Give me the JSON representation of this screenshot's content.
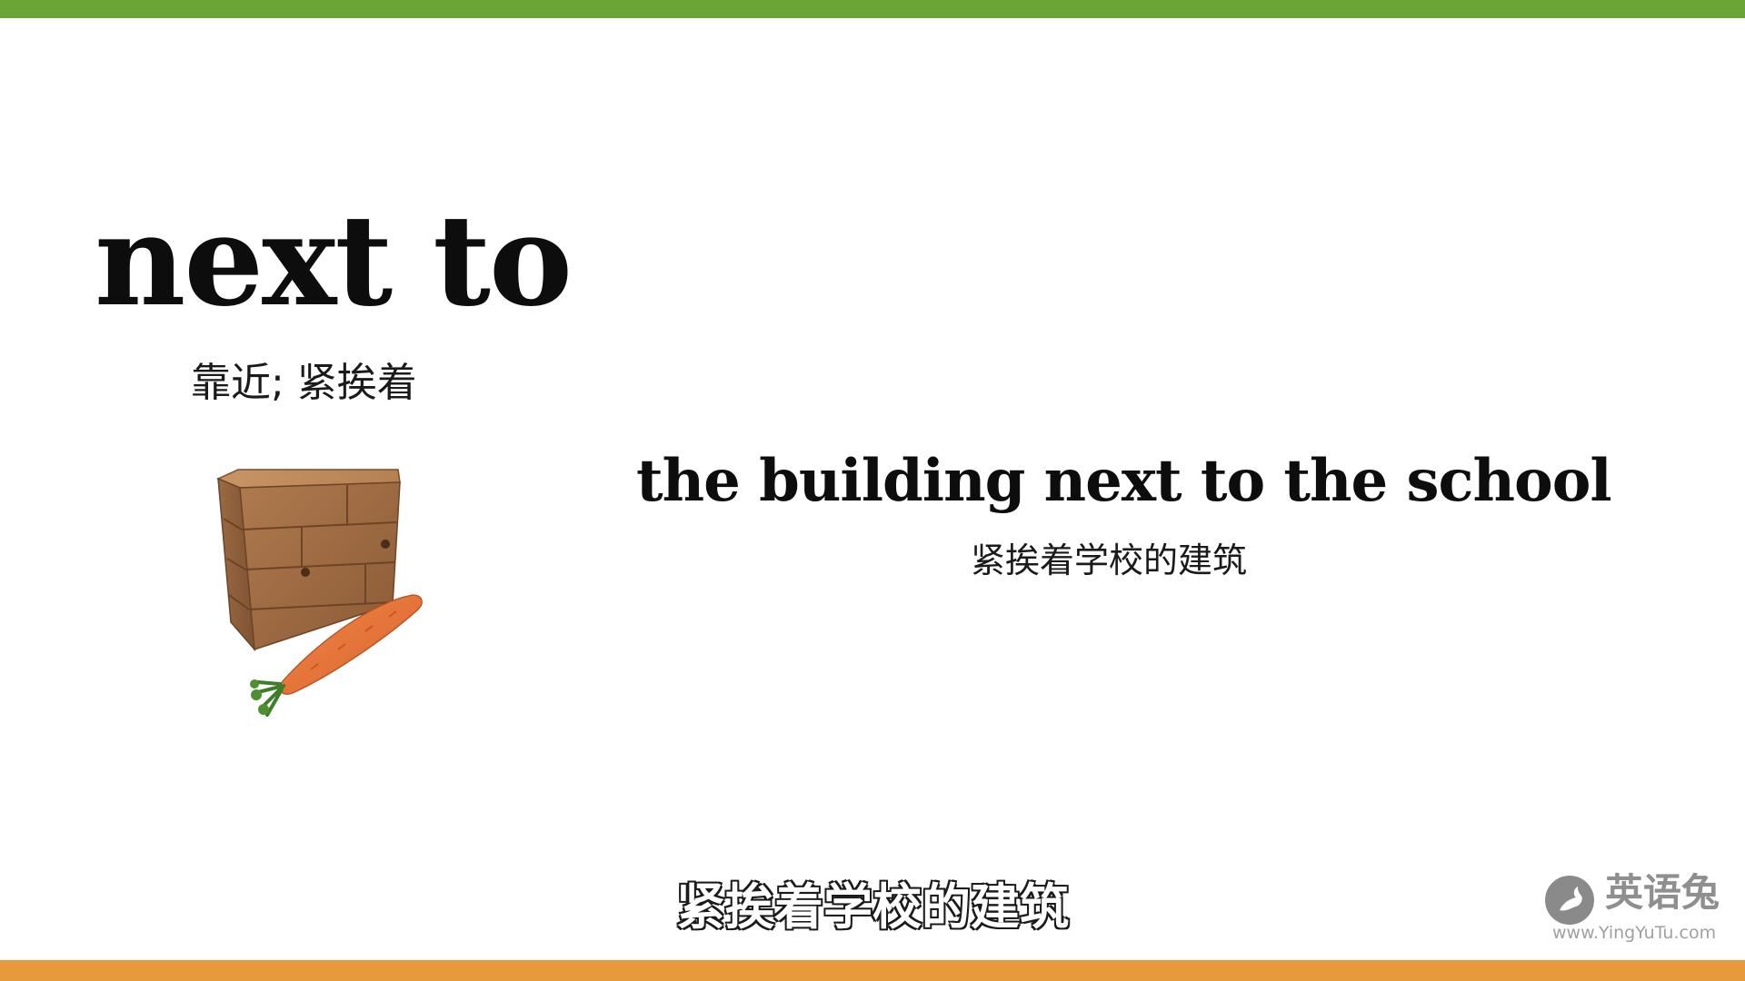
{
  "theme": {
    "top_bar_color": "#6aa535",
    "bottom_bar_color": "#e79a3b",
    "background": "#ffffff"
  },
  "vocab": {
    "headword": "next to",
    "meaning": "靠近; 紧挨着"
  },
  "example": {
    "sentence": "the building next to the school",
    "translation": "紧挨着学校的建筑"
  },
  "subtitle": {
    "text": "紧挨着学校的建筑"
  },
  "illustration": {
    "icon": "wooden-block-cube-with-carrot"
  },
  "watermark": {
    "icon": "rabbit-logo-icon",
    "name": "英语兔",
    "url": "www.YingYuTu.com"
  }
}
